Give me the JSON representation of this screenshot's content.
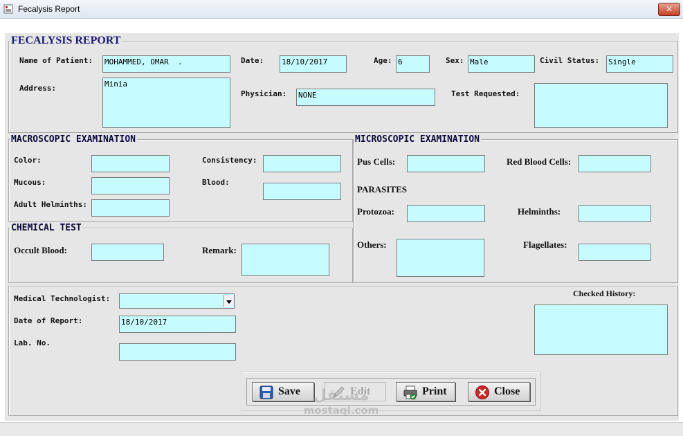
{
  "window": {
    "title": "Fecalysis Report",
    "close_glyph": "✕"
  },
  "form": {
    "heading": "FECALYSIS REPORT",
    "patient_name": {
      "label": "Name of Patient:",
      "value": "MOHAMMED, OMAR  ."
    },
    "date": {
      "label": "Date:",
      "value": "18/10/2017"
    },
    "age": {
      "label": "Age:",
      "value": "6"
    },
    "sex": {
      "label": "Sex:",
      "value": "Male"
    },
    "civil_status": {
      "label": "Civil Status:",
      "value": "Single"
    },
    "address": {
      "label": "Address:",
      "value": "Minia"
    },
    "physician": {
      "label": "Physician:",
      "value": "NONE"
    },
    "test_requested": {
      "label": "Test Requested:",
      "value": ""
    }
  },
  "macroscopic": {
    "heading": "MACROSCOPIC EXAMINATION",
    "color": {
      "label": "Color:",
      "value": ""
    },
    "consistency": {
      "label": "Consistency:",
      "value": ""
    },
    "mucous": {
      "label": "Mucous:",
      "value": ""
    },
    "blood": {
      "label": "Blood:",
      "value": ""
    },
    "adult_helminths": {
      "label": "Adult Helminths:",
      "value": ""
    }
  },
  "chemical": {
    "heading": "CHEMICAL TEST",
    "occult_blood": {
      "label": "Occult Blood:",
      "value": ""
    },
    "remark": {
      "label": "Remark:",
      "value": ""
    }
  },
  "microscopic": {
    "heading": "MICROSCOPIC EXAMINATION",
    "pus_cells": {
      "label": "Pus Cells:",
      "value": ""
    },
    "red_blood_cells": {
      "label": "Red Blood Cells:",
      "value": ""
    },
    "parasites_heading": "PARASITES",
    "protozoa": {
      "label": "Protozoa:",
      "value": ""
    },
    "helminths": {
      "label": "Helminths:",
      "value": ""
    },
    "others": {
      "label": "Others:",
      "value": ""
    },
    "flagellates": {
      "label": "Flagellates:",
      "value": ""
    }
  },
  "report": {
    "medical_technologist": {
      "label": "Medical Technologist:",
      "value": ""
    },
    "date_of_report": {
      "label": "Date of Report:",
      "value": "18/10/2017"
    },
    "lab_no": {
      "label": "Lab. No.",
      "value": ""
    },
    "checked_history": {
      "label": "Checked History:",
      "value": ""
    }
  },
  "buttons": {
    "save": {
      "label": "Save",
      "icon": "floppy-disk-icon"
    },
    "edit": {
      "label": "Edit",
      "icon": "pencil-icon"
    },
    "print": {
      "label": "Print",
      "icon": "printer-icon"
    },
    "close": {
      "label": "Close",
      "icon": "close-circle-icon"
    }
  },
  "watermark": {
    "line1": "مستقل",
    "line2": "mostaql.com"
  },
  "colors": {
    "field_bg": "#c6fcff",
    "heading_text": "#0b0b3b",
    "panel_bg": "#e6e6e6"
  }
}
